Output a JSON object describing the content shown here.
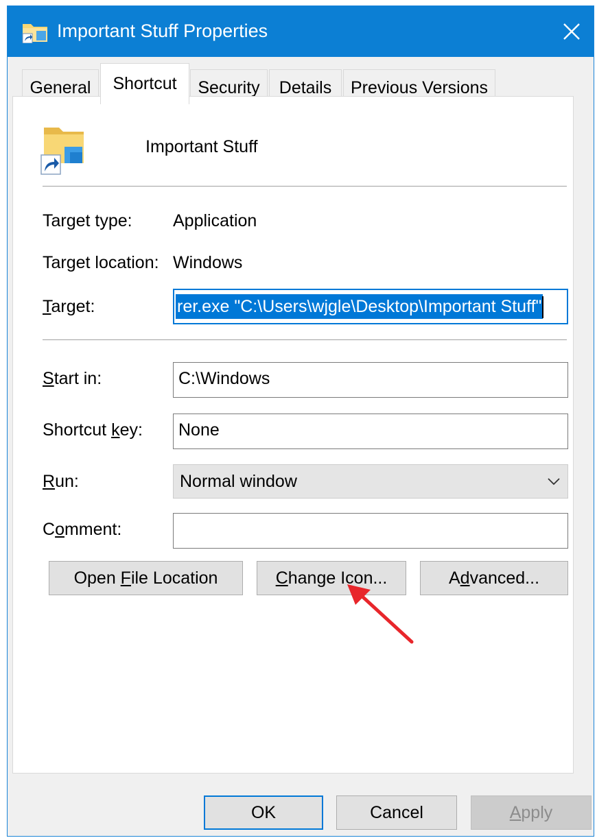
{
  "window": {
    "title": "Important Stuff Properties",
    "title_icon": "folder-shortcut-icon",
    "close_icon": "close-icon",
    "accent": "#0c7fd4"
  },
  "tabs": [
    {
      "label": "General",
      "active": false
    },
    {
      "label": "Shortcut",
      "active": true
    },
    {
      "label": "Security",
      "active": false
    },
    {
      "label": "Details",
      "active": false
    },
    {
      "label": "Previous Versions",
      "active": false
    }
  ],
  "shortcut": {
    "icon": "folder-shortcut-icon",
    "name": "Important Stuff",
    "target_type_label": "Target type:",
    "target_type_value": "Application",
    "target_location_label": "Target location:",
    "target_location_value": "Windows",
    "target_label": "Target:",
    "target_value": "rer.exe \"C:\\Users\\wjgle\\Desktop\\Important Stuff\"",
    "start_in_label": "Start in:",
    "start_in_value": "C:\\Windows",
    "shortcut_key_label": "Shortcut key:",
    "shortcut_key_value": "None",
    "run_label": "Run:",
    "run_value": "Normal window",
    "comment_label": "Comment:",
    "comment_value": "",
    "open_file_location": "Open File Location",
    "change_icon": "Change Icon...",
    "advanced": "Advanced..."
  },
  "footer": {
    "ok": "OK",
    "cancel": "Cancel",
    "apply": "Apply"
  },
  "annotation": {
    "icon": "red-arrow-icon",
    "color": "#e8262b"
  }
}
